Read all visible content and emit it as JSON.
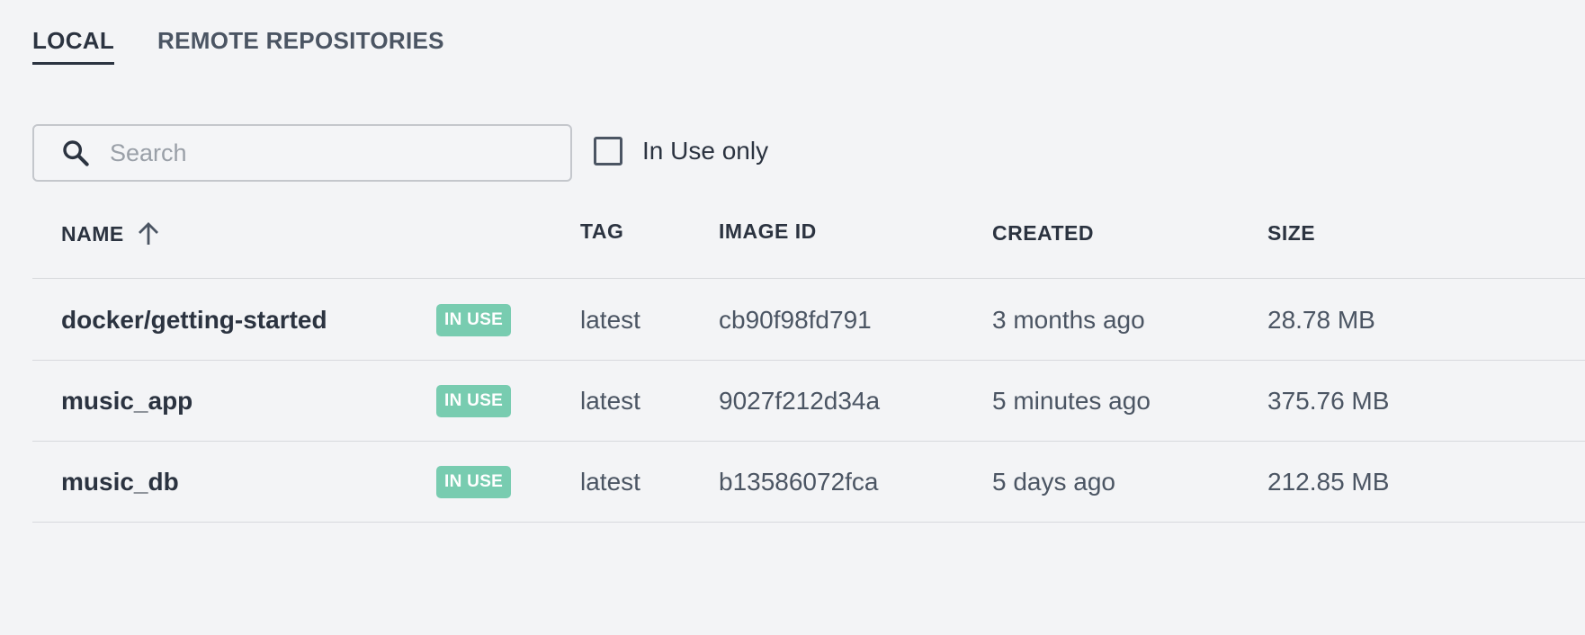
{
  "tabs": [
    {
      "label": "LOCAL",
      "active": true
    },
    {
      "label": "REMOTE REPOSITORIES",
      "active": false
    }
  ],
  "search": {
    "placeholder": "Search",
    "value": "",
    "icon": "search-icon"
  },
  "filter": {
    "label": "In Use only",
    "checked": false
  },
  "table": {
    "columns": {
      "name": "NAME",
      "tag": "TAG",
      "image_id": "IMAGE ID",
      "created": "CREATED",
      "size": "SIZE"
    },
    "sort_icon": "arrow-up-icon",
    "rows": [
      {
        "name": "docker/getting-started",
        "badge": "IN USE",
        "tag": "latest",
        "image_id": "cb90f98fd791",
        "created": "3 months ago",
        "size": "28.78 MB"
      },
      {
        "name": "music_app",
        "badge": "IN USE",
        "tag": "latest",
        "image_id": "9027f212d34a",
        "created": "5 minutes ago",
        "size": "375.76 MB"
      },
      {
        "name": "music_db",
        "badge": "IN USE",
        "tag": "latest",
        "image_id": "b13586072fca",
        "created": "5 days ago",
        "size": "212.85 MB"
      }
    ]
  },
  "colors": {
    "background": "#f3f4f6",
    "text": "#2b3340",
    "badge": "#78ccb0"
  }
}
